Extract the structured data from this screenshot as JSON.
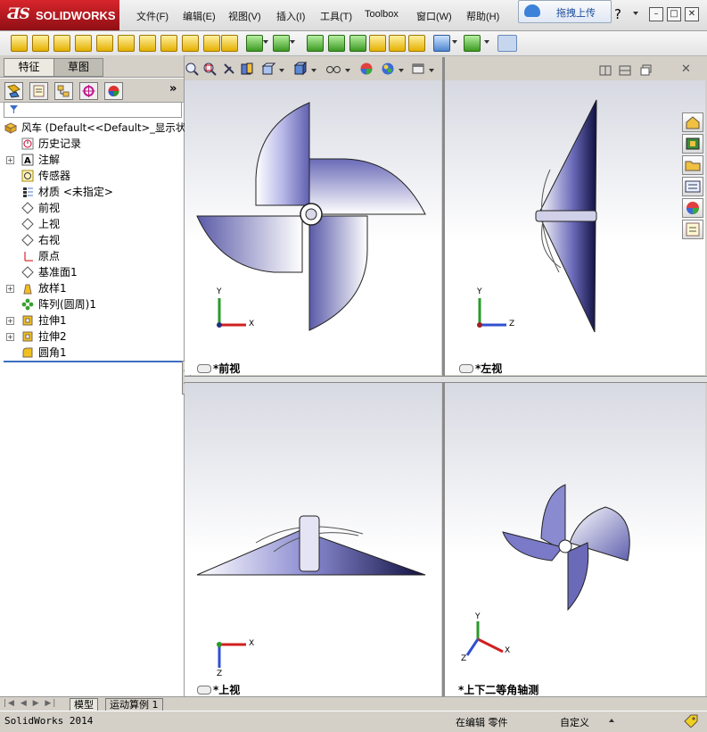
{
  "app": {
    "brand_mark": "ƋS",
    "brand_name": "SOLIDWORKS"
  },
  "menu": [
    "文件(F)",
    "编辑(E)",
    "视图(V)",
    "插入(I)",
    "工具(T)",
    "Toolbox",
    "窗口(W)",
    "帮助(H)"
  ],
  "upload_button": "拖拽上传",
  "help_glyph": "?",
  "window_controls": {
    "minimize": "–",
    "restore": "□",
    "close": "✕"
  },
  "tabs": {
    "feature": "特征",
    "sketch": "草图"
  },
  "tree": {
    "root": "风车  (Default<<Default>_显示状",
    "items": [
      "历史记录",
      "注解",
      "传感器",
      "材质 <未指定>",
      "前视",
      "上视",
      "右视",
      "原点",
      "基准面1",
      "放样1",
      "阵列(圆周)1",
      "拉伸1",
      "拉伸2",
      "圆角1"
    ]
  },
  "viewports": {
    "front": "*前视",
    "left": "*左视",
    "top": "*上视",
    "iso": "*上下二等角轴测"
  },
  "triad": {
    "x": "X",
    "y": "Y",
    "z": "Z"
  },
  "bottom_tabs": {
    "model": "模型",
    "motion": "运动算例 1"
  },
  "status": {
    "app_version": "SolidWorks 2014",
    "editing": "在编辑 零件",
    "units": "自定义"
  },
  "colors": {
    "accent": "#3c6fc0",
    "model_face": "#8a8ad0",
    "brand_red": "#c0141c"
  }
}
